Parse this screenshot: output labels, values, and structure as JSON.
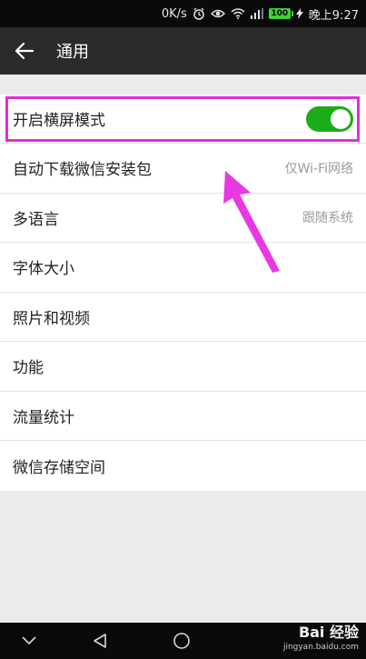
{
  "status_bar": {
    "net_speed": "0K/s",
    "battery": "100",
    "time": "晚上9:27"
  },
  "header": {
    "title": "通用"
  },
  "settings": [
    {
      "label": "开启横屏模式",
      "value": "",
      "toggle": true
    },
    {
      "label": "自动下载微信安装包",
      "value": "仅Wi-Fi网络"
    },
    {
      "label": "多语言",
      "value": "跟随系统"
    },
    {
      "label": "字体大小",
      "value": ""
    },
    {
      "label": "照片和视频",
      "value": ""
    },
    {
      "label": "功能",
      "value": ""
    },
    {
      "label": "流量统计",
      "value": ""
    },
    {
      "label": "微信存储空间",
      "value": ""
    }
  ],
  "watermark": {
    "brand": "Bai 经验",
    "url": "jingyan.baidu.com"
  },
  "colors": {
    "toggle_on": "#1aad19",
    "highlight": "#e02ddb",
    "header_bg": "#2b2b2b"
  }
}
